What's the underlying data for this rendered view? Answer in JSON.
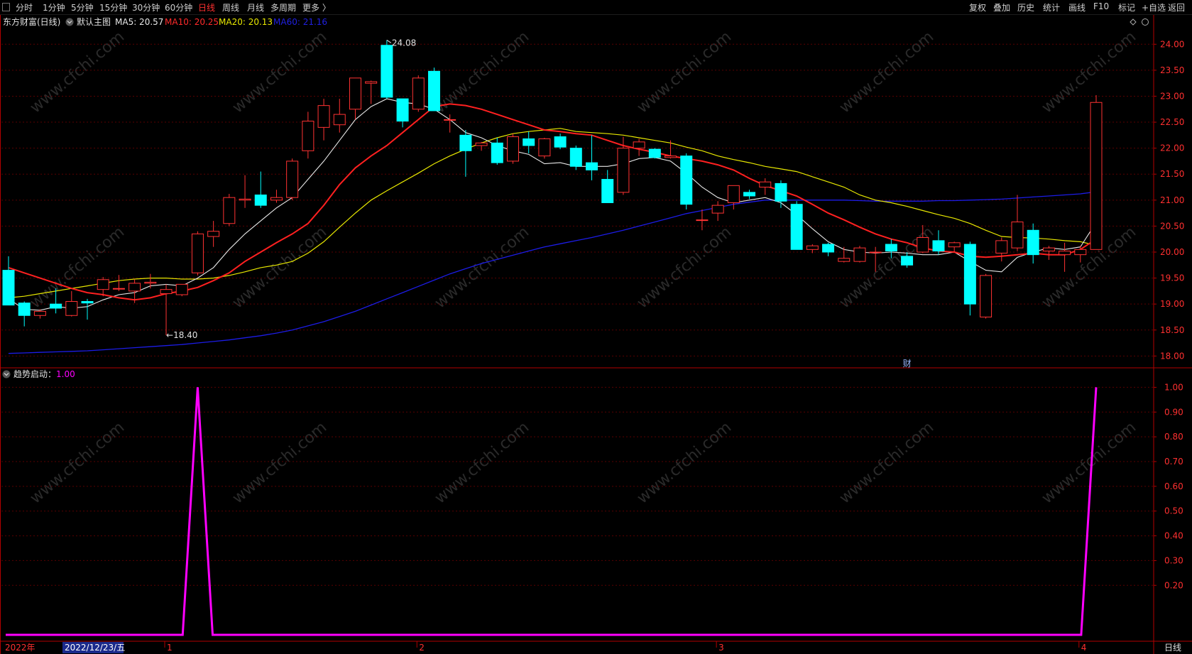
{
  "toolbar": {
    "left_items": [
      {
        "label": "分时",
        "active": false
      },
      {
        "label": "1分钟",
        "active": false
      },
      {
        "label": "5分钟",
        "active": false
      },
      {
        "label": "15分钟",
        "active": false
      },
      {
        "label": "30分钟",
        "active": false
      },
      {
        "label": "60分钟",
        "active": false
      },
      {
        "label": "日线",
        "active": true
      },
      {
        "label": "周线",
        "active": false
      },
      {
        "label": "月线",
        "active": false
      },
      {
        "label": "多周期",
        "active": false
      },
      {
        "label": "更多 〉",
        "active": false
      }
    ],
    "right_items": [
      "复权",
      "叠加",
      "历史",
      "统计",
      "画线",
      "F10",
      "标记",
      "+自选",
      "返回"
    ]
  },
  "main_header": {
    "stock_label": "东方财富(日线)",
    "indicator_name": "默认主图",
    "ma_legend": [
      {
        "label": "MA5: 20.57",
        "color": "#e8e8e8"
      },
      {
        "label": "MA10: 20.25",
        "color": "#ff2a2a"
      },
      {
        "label": "MA20: 20.13",
        "color": "#e8e800"
      },
      {
        "label": "MA60: 21.16",
        "color": "#2020e0"
      }
    ]
  },
  "sub_header": {
    "indicator_name": "趋势启动：",
    "value": "1.00"
  },
  "colors": {
    "up": "#ff3232",
    "down": "#00ffff",
    "ma5": "#e8e8e8",
    "ma10": "#ff2020",
    "ma20": "#e8e800",
    "ma60": "#1c1ce6",
    "signal": "#ff00ff",
    "axis": "#b30000",
    "axis_text": "#ff3030",
    "grid": "#5a0000"
  },
  "chart_data": [
    {
      "type": "candlestick",
      "name": "东方财富(日线)",
      "ylim": [
        17.95,
        24.25
      ],
      "y_ticks": [
        "24.00",
        "23.50",
        "23.00",
        "22.50",
        "22.00",
        "21.50",
        "21.00",
        "20.50",
        "20.00",
        "19.50",
        "19.00",
        "18.50",
        "18.00"
      ],
      "candles": [
        {
          "o": 19.65,
          "h": 19.92,
          "l": 18.98,
          "c": 18.98
        },
        {
          "o": 19.02,
          "h": 19.05,
          "l": 18.57,
          "c": 18.78
        },
        {
          "o": 18.78,
          "h": 18.9,
          "l": 18.72,
          "c": 18.86
        },
        {
          "o": 19.0,
          "h": 19.3,
          "l": 18.82,
          "c": 18.92
        },
        {
          "o": 18.78,
          "h": 19.25,
          "l": 18.76,
          "c": 19.05
        },
        {
          "o": 19.05,
          "h": 19.1,
          "l": 18.7,
          "c": 19.02
        },
        {
          "o": 19.28,
          "h": 19.52,
          "l": 19.15,
          "c": 19.47
        },
        {
          "o": 19.3,
          "h": 19.56,
          "l": 19.25,
          "c": 19.3
        },
        {
          "o": 19.25,
          "h": 19.48,
          "l": 19.02,
          "c": 19.4
        },
        {
          "o": 19.4,
          "h": 19.58,
          "l": 19.3,
          "c": 19.42
        },
        {
          "o": 19.2,
          "h": 19.38,
          "l": 18.4,
          "c": 19.28
        },
        {
          "o": 19.18,
          "h": 19.38,
          "l": 19.15,
          "c": 19.38
        },
        {
          "o": 19.6,
          "h": 20.4,
          "l": 19.55,
          "c": 20.35
        },
        {
          "o": 20.3,
          "h": 20.6,
          "l": 20.1,
          "c": 20.4
        },
        {
          "o": 20.55,
          "h": 21.12,
          "l": 20.5,
          "c": 21.05
        },
        {
          "o": 21.0,
          "h": 21.48,
          "l": 20.85,
          "c": 21.02
        },
        {
          "o": 21.1,
          "h": 21.55,
          "l": 20.85,
          "c": 20.9
        },
        {
          "o": 21.0,
          "h": 21.2,
          "l": 20.95,
          "c": 21.05
        },
        {
          "o": 21.05,
          "h": 21.8,
          "l": 21.0,
          "c": 21.75
        },
        {
          "o": 21.95,
          "h": 22.7,
          "l": 21.8,
          "c": 22.52
        },
        {
          "o": 22.4,
          "h": 22.95,
          "l": 22.15,
          "c": 22.82
        },
        {
          "o": 22.45,
          "h": 22.95,
          "l": 22.3,
          "c": 22.65
        },
        {
          "o": 22.75,
          "h": 23.35,
          "l": 22.55,
          "c": 23.35
        },
        {
          "o": 23.25,
          "h": 23.3,
          "l": 22.85,
          "c": 23.28
        },
        {
          "o": 23.98,
          "h": 24.08,
          "l": 22.95,
          "c": 22.98
        },
        {
          "o": 22.95,
          "h": 22.95,
          "l": 22.4,
          "c": 22.52
        },
        {
          "o": 22.75,
          "h": 23.4,
          "l": 22.7,
          "c": 23.35
        },
        {
          "o": 23.48,
          "h": 23.55,
          "l": 22.75,
          "c": 22.72
        },
        {
          "o": 22.55,
          "h": 22.65,
          "l": 22.3,
          "c": 22.55
        },
        {
          "o": 22.25,
          "h": 22.35,
          "l": 21.45,
          "c": 21.95
        },
        {
          "o": 22.05,
          "h": 22.12,
          "l": 21.95,
          "c": 22.1
        },
        {
          "o": 22.1,
          "h": 22.2,
          "l": 21.68,
          "c": 21.72
        },
        {
          "o": 21.75,
          "h": 22.28,
          "l": 21.7,
          "c": 22.22
        },
        {
          "o": 22.18,
          "h": 22.32,
          "l": 21.9,
          "c": 22.05
        },
        {
          "o": 21.85,
          "h": 22.2,
          "l": 21.8,
          "c": 22.18
        },
        {
          "o": 22.22,
          "h": 22.28,
          "l": 21.98,
          "c": 22.02
        },
        {
          "o": 22.0,
          "h": 22.05,
          "l": 21.58,
          "c": 21.65
        },
        {
          "o": 21.72,
          "h": 22.25,
          "l": 21.38,
          "c": 21.58
        },
        {
          "o": 21.4,
          "h": 21.58,
          "l": 20.95,
          "c": 20.95
        },
        {
          "o": 21.15,
          "h": 22.22,
          "l": 21.1,
          "c": 22.0
        },
        {
          "o": 22.0,
          "h": 22.18,
          "l": 21.85,
          "c": 22.12
        },
        {
          "o": 21.98,
          "h": 22.0,
          "l": 21.8,
          "c": 21.82
        },
        {
          "o": 21.82,
          "h": 22.15,
          "l": 21.8,
          "c": 21.85
        },
        {
          "o": 21.85,
          "h": 21.9,
          "l": 20.82,
          "c": 20.92
        },
        {
          "o": 20.62,
          "h": 20.82,
          "l": 20.42,
          "c": 20.62
        },
        {
          "o": 20.75,
          "h": 20.98,
          "l": 20.6,
          "c": 20.9
        },
        {
          "o": 20.95,
          "h": 21.28,
          "l": 20.82,
          "c": 21.28
        },
        {
          "o": 21.15,
          "h": 21.2,
          "l": 21.02,
          "c": 21.08
        },
        {
          "o": 21.25,
          "h": 21.42,
          "l": 21.1,
          "c": 21.35
        },
        {
          "o": 21.32,
          "h": 21.38,
          "l": 20.85,
          "c": 20.98
        },
        {
          "o": 20.92,
          "h": 20.98,
          "l": 20.05,
          "c": 20.05
        },
        {
          "o": 20.05,
          "h": 20.15,
          "l": 19.98,
          "c": 20.12
        },
        {
          "o": 20.15,
          "h": 20.18,
          "l": 19.92,
          "c": 20.0
        },
        {
          "o": 19.82,
          "h": 20.1,
          "l": 19.8,
          "c": 19.88
        },
        {
          "o": 19.82,
          "h": 20.12,
          "l": 19.8,
          "c": 20.08
        },
        {
          "o": 20.0,
          "h": 20.1,
          "l": 19.62,
          "c": 20.0
        },
        {
          "o": 20.15,
          "h": 20.25,
          "l": 19.88,
          "c": 20.02
        },
        {
          "o": 19.92,
          "h": 20.0,
          "l": 19.7,
          "c": 19.75
        },
        {
          "o": 20.0,
          "h": 20.52,
          "l": 19.98,
          "c": 20.28
        },
        {
          "o": 20.22,
          "h": 20.42,
          "l": 19.95,
          "c": 20.02
        },
        {
          "o": 20.1,
          "h": 20.2,
          "l": 20.0,
          "c": 20.18
        },
        {
          "o": 20.15,
          "h": 20.2,
          "l": 18.78,
          "c": 19.0
        },
        {
          "o": 18.75,
          "h": 19.58,
          "l": 18.72,
          "c": 19.55
        },
        {
          "o": 19.98,
          "h": 20.28,
          "l": 19.82,
          "c": 20.22
        },
        {
          "o": 20.08,
          "h": 21.1,
          "l": 20.02,
          "c": 20.58
        },
        {
          "o": 20.42,
          "h": 20.55,
          "l": 19.78,
          "c": 19.95
        },
        {
          "o": 20.02,
          "h": 20.12,
          "l": 19.85,
          "c": 20.08
        },
        {
          "o": 19.95,
          "h": 20.18,
          "l": 19.62,
          "c": 20.02
        },
        {
          "o": 19.95,
          "h": 20.12,
          "l": 19.8,
          "c": 20.05
        },
        {
          "o": 20.05,
          "h": 23.02,
          "l": 20.05,
          "c": 22.88
        }
      ],
      "ma5": [
        19.1,
        18.9,
        18.88,
        18.95,
        18.92,
        18.95,
        19.08,
        19.18,
        19.22,
        19.35,
        19.38,
        19.35,
        19.5,
        19.7,
        20.05,
        20.35,
        20.6,
        20.85,
        21.05,
        21.4,
        21.75,
        22.15,
        22.55,
        22.8,
        22.95,
        22.88,
        22.85,
        22.75,
        22.55,
        22.3,
        22.2,
        22.05,
        21.95,
        21.88,
        21.7,
        21.72,
        21.65,
        21.65,
        21.65,
        21.7,
        21.8,
        21.82,
        21.75,
        21.52,
        21.25,
        21.05,
        20.95,
        21.0,
        21.05,
        20.95,
        20.72,
        20.45,
        20.2,
        20.05,
        20.0,
        19.98,
        20.0,
        19.98,
        19.95,
        19.95,
        20.0,
        19.82,
        19.65,
        19.62,
        19.9,
        20.0,
        20.08,
        20.05,
        20.1,
        20.57
      ],
      "ma10": [
        19.7,
        19.6,
        19.5,
        19.4,
        19.3,
        19.22,
        19.18,
        19.12,
        19.08,
        19.12,
        19.2,
        19.25,
        19.32,
        19.45,
        19.6,
        19.82,
        20.0,
        20.18,
        20.35,
        20.55,
        20.9,
        21.3,
        21.62,
        21.85,
        22.05,
        22.3,
        22.55,
        22.8,
        22.85,
        22.82,
        22.75,
        22.65,
        22.55,
        22.45,
        22.35,
        22.32,
        22.28,
        22.25,
        22.15,
        22.05,
        21.98,
        21.92,
        21.85,
        21.8,
        21.75,
        21.68,
        21.58,
        21.42,
        21.28,
        21.18,
        21.08,
        20.92,
        20.75,
        20.62,
        20.48,
        20.35,
        20.25,
        20.18,
        20.08,
        20.02,
        20.0,
        19.92,
        19.9,
        19.92,
        19.95,
        19.98,
        19.95,
        19.95,
        20.05,
        20.25
      ],
      "ma20": [
        19.12,
        19.15,
        19.2,
        19.25,
        19.3,
        19.35,
        19.4,
        19.45,
        19.48,
        19.5,
        19.5,
        19.48,
        19.48,
        19.5,
        19.55,
        19.62,
        19.7,
        19.75,
        19.82,
        19.98,
        20.2,
        20.48,
        20.75,
        21.0,
        21.18,
        21.35,
        21.52,
        21.7,
        21.85,
        21.98,
        22.1,
        22.2,
        22.28,
        22.32,
        22.35,
        22.38,
        22.32,
        22.3,
        22.28,
        22.25,
        22.2,
        22.15,
        22.1,
        22.02,
        21.95,
        21.85,
        21.78,
        21.72,
        21.65,
        21.6,
        21.55,
        21.45,
        21.35,
        21.25,
        21.1,
        21.0,
        20.95,
        20.88,
        20.8,
        20.72,
        20.65,
        20.55,
        20.42,
        20.3,
        20.28,
        20.27,
        20.25,
        20.22,
        20.2,
        20.13
      ],
      "ma60": [
        18.05,
        18.06,
        18.07,
        18.08,
        18.09,
        18.1,
        18.12,
        18.14,
        18.16,
        18.18,
        18.2,
        18.22,
        18.25,
        18.28,
        18.31,
        18.35,
        18.39,
        18.44,
        18.5,
        18.58,
        18.66,
        18.76,
        18.86,
        18.98,
        19.1,
        19.22,
        19.34,
        19.46,
        19.58,
        19.68,
        19.78,
        19.86,
        19.94,
        20.02,
        20.1,
        20.16,
        20.22,
        20.28,
        20.35,
        20.42,
        20.5,
        20.58,
        20.66,
        20.74,
        20.8,
        20.86,
        20.92,
        20.96,
        21.0,
        21.0,
        21.0,
        21.0,
        21.0,
        21.0,
        20.99,
        20.98,
        20.98,
        20.98,
        20.98,
        20.99,
        20.99,
        21.0,
        21.01,
        21.02,
        21.04,
        21.06,
        21.08,
        21.1,
        21.12,
        21.16
      ],
      "annotations": [
        {
          "text": "24.08",
          "index": 24,
          "value": 24.08,
          "kind": "high"
        },
        {
          "text": "←18.40",
          "index": 10,
          "value": 18.4,
          "kind": "low"
        },
        {
          "text": "财",
          "index": 57,
          "kind": "event"
        }
      ]
    },
    {
      "type": "line",
      "name": "趋势启动",
      "ylim": [
        0,
        1.05
      ],
      "y_ticks": [
        "1.00",
        "0.90",
        "0.80",
        "0.70",
        "0.60",
        "0.50",
        "0.40",
        "0.30",
        "0.20"
      ],
      "values": [
        0,
        0,
        0,
        0,
        0,
        0,
        0,
        0,
        0,
        0,
        0,
        0,
        1,
        0,
        0,
        0,
        0,
        0,
        0,
        0,
        0,
        0,
        0,
        0,
        0,
        0,
        0,
        0,
        0,
        0,
        0,
        0,
        0,
        0,
        0,
        0,
        0,
        0,
        0,
        0,
        0,
        0,
        0,
        0,
        0,
        0,
        0,
        0,
        0,
        0,
        0,
        0,
        0,
        0,
        0,
        0,
        0,
        0,
        0,
        0,
        0,
        0,
        0,
        0,
        0,
        0,
        0,
        0,
        0,
        1
      ]
    }
  ],
  "x_axis": {
    "labels": [
      {
        "text": "2022年",
        "index": 0
      },
      {
        "text": "1",
        "index": 10
      },
      {
        "text": "2",
        "index": 26
      },
      {
        "text": "3",
        "index": 45
      },
      {
        "text": "4",
        "index": 68
      }
    ],
    "cursor_label": "2022/12/23/五",
    "right_label": "日线"
  },
  "watermark": "www.cfchi.com"
}
